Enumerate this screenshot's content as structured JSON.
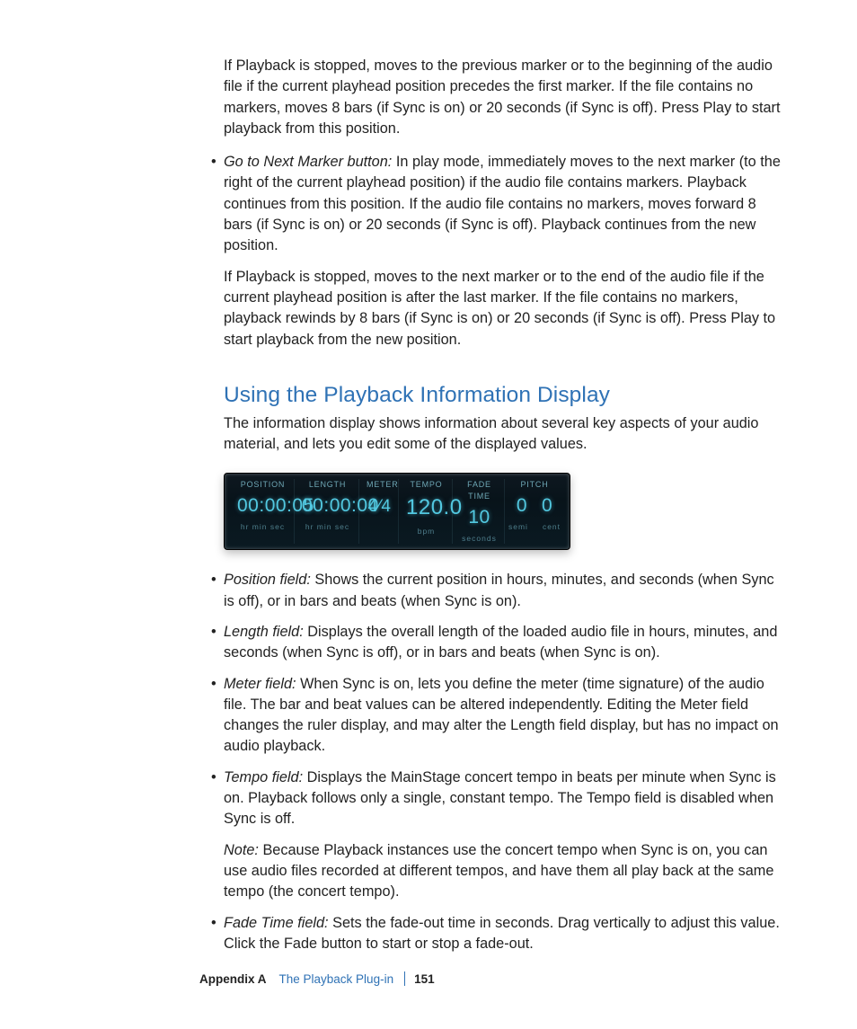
{
  "p_prev_stopped": "If Playback is stopped, moves to the previous marker or to the beginning of the audio file if the current playhead position precedes the first marker. If the file contains no markers, moves 8 bars (if Sync is on) or 20 seconds (if Sync is off). Press Play to start playback from this position.",
  "next_btn_term": "Go to Next Marker button:",
  "next_btn_desc": "  In play mode, immediately moves to the next marker (to the right of the current playhead position) if the audio file contains markers. Playback continues from this position. If the audio file contains no markers, moves forward 8 bars (if Sync is on) or 20 seconds (if Sync is off). Playback continues from the new position.",
  "p_next_stopped": "If Playback is stopped, moves to the next marker or to the end of the audio file if the current playhead position is after the last marker. If the file contains no markers, playback rewinds by 8 bars (if Sync is on) or 20 seconds (if Sync is off). Press Play to start playback from the new position.",
  "heading": "Using the Playback Information Display",
  "intro": "The information display shows information about several key aspects of your audio material, and lets you edit some of the displayed values.",
  "display": {
    "position": {
      "label": "POSITION",
      "value": "00:00:05",
      "sub": "hr   min   sec"
    },
    "length": {
      "label": "LENGTH",
      "value": "00:00:00",
      "sub": "hr   min   sec"
    },
    "meter": {
      "label": "METER",
      "value": "4⁄4"
    },
    "tempo": {
      "label": "TEMPO",
      "value": "120.0",
      "sub": "bpm"
    },
    "fade": {
      "label": "FADE TIME",
      "value": "10",
      "sub": "seconds"
    },
    "pitch": {
      "label": "PITCH",
      "semi": "0",
      "cent": "0",
      "sub_semi": "semi",
      "sub_cent": "cent"
    }
  },
  "fields": {
    "position": {
      "term": "Position field:",
      "desc": "  Shows the current position in hours, minutes, and seconds (when Sync is off), or in bars and beats (when Sync is on)."
    },
    "length": {
      "term": "Length field:",
      "desc": "  Displays the overall length of the loaded audio file in hours, minutes, and seconds (when Sync is off), or in bars and beats (when Sync is on)."
    },
    "meter": {
      "term": "Meter field:",
      "desc": "  When Sync is on, lets you define the meter (time signature) of the audio file. The bar and beat values can be altered independently. Editing the Meter field changes the ruler display, and may alter the Length field display, but has no impact on audio playback."
    },
    "tempo": {
      "term": "Tempo field:",
      "desc": "  Displays the MainStage concert tempo in beats per minute when Sync is on. Playback follows only a single, constant tempo. The Tempo field is disabled when Sync is off."
    },
    "tempo_note_term": "Note:",
    "tempo_note_desc": "  Because Playback instances use the concert tempo when Sync is on, you can use audio files recorded at different tempos, and have them all play back at the same tempo (the concert tempo).",
    "fade": {
      "term": "Fade Time field:",
      "desc": "  Sets the fade-out time in seconds. Drag vertically to adjust this value. Click the Fade button to start or stop a fade-out."
    }
  },
  "footer": {
    "appendix": "Appendix A",
    "title": "The Playback Plug-in",
    "page": "151"
  },
  "bullet": "•"
}
